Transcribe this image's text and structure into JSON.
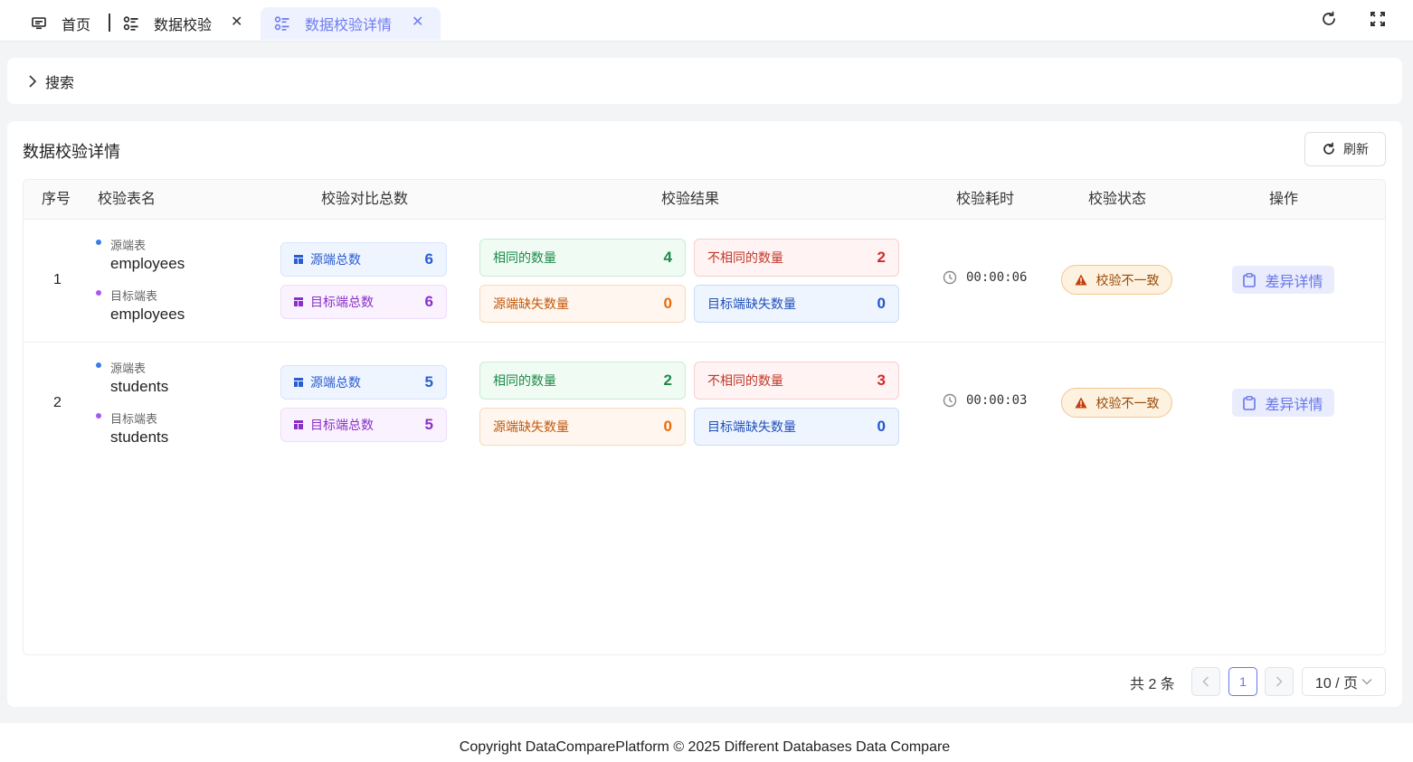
{
  "tabs": {
    "home": "首页",
    "check": "数据校验",
    "detail": "数据校验详情"
  },
  "search": {
    "label": "搜索"
  },
  "card": {
    "title": "数据校验详情",
    "refresh_label": "刷新"
  },
  "table": {
    "headers": {
      "index": "序号",
      "name": "校验表名",
      "total": "校验对比总数",
      "result": "校验结果",
      "duration": "校验耗时",
      "status": "校验状态",
      "action": "操作"
    },
    "labels": {
      "source_table": "源端表",
      "target_table": "目标端表",
      "source_total": "源端总数",
      "target_total": "目标端总数",
      "same": "相同的数量",
      "diff": "不相同的数量",
      "source_missing": "源端缺失数量",
      "target_missing": "目标端缺失数量",
      "detail_btn": "差异详情"
    },
    "rows": [
      {
        "index": "1",
        "source_table": "employees",
        "target_table": "employees",
        "source_total": "6",
        "target_total": "6",
        "same": "4",
        "diff": "2",
        "source_missing": "0",
        "target_missing": "0",
        "duration": "00:00:06",
        "status": "校验不一致"
      },
      {
        "index": "2",
        "source_table": "students",
        "target_table": "students",
        "source_total": "5",
        "target_total": "5",
        "same": "2",
        "diff": "3",
        "source_missing": "0",
        "target_missing": "0",
        "duration": "00:00:03",
        "status": "校验不一致"
      }
    ]
  },
  "pagination": {
    "total": "共 2 条",
    "current_page": "1",
    "page_size": "10 / 页"
  },
  "footer": {
    "copyright": "Copyright DataComparePlatform © 2025 Different Databases Data Compare"
  },
  "colors": {
    "accent": "#6776e8",
    "warning": "#f3c58d"
  }
}
